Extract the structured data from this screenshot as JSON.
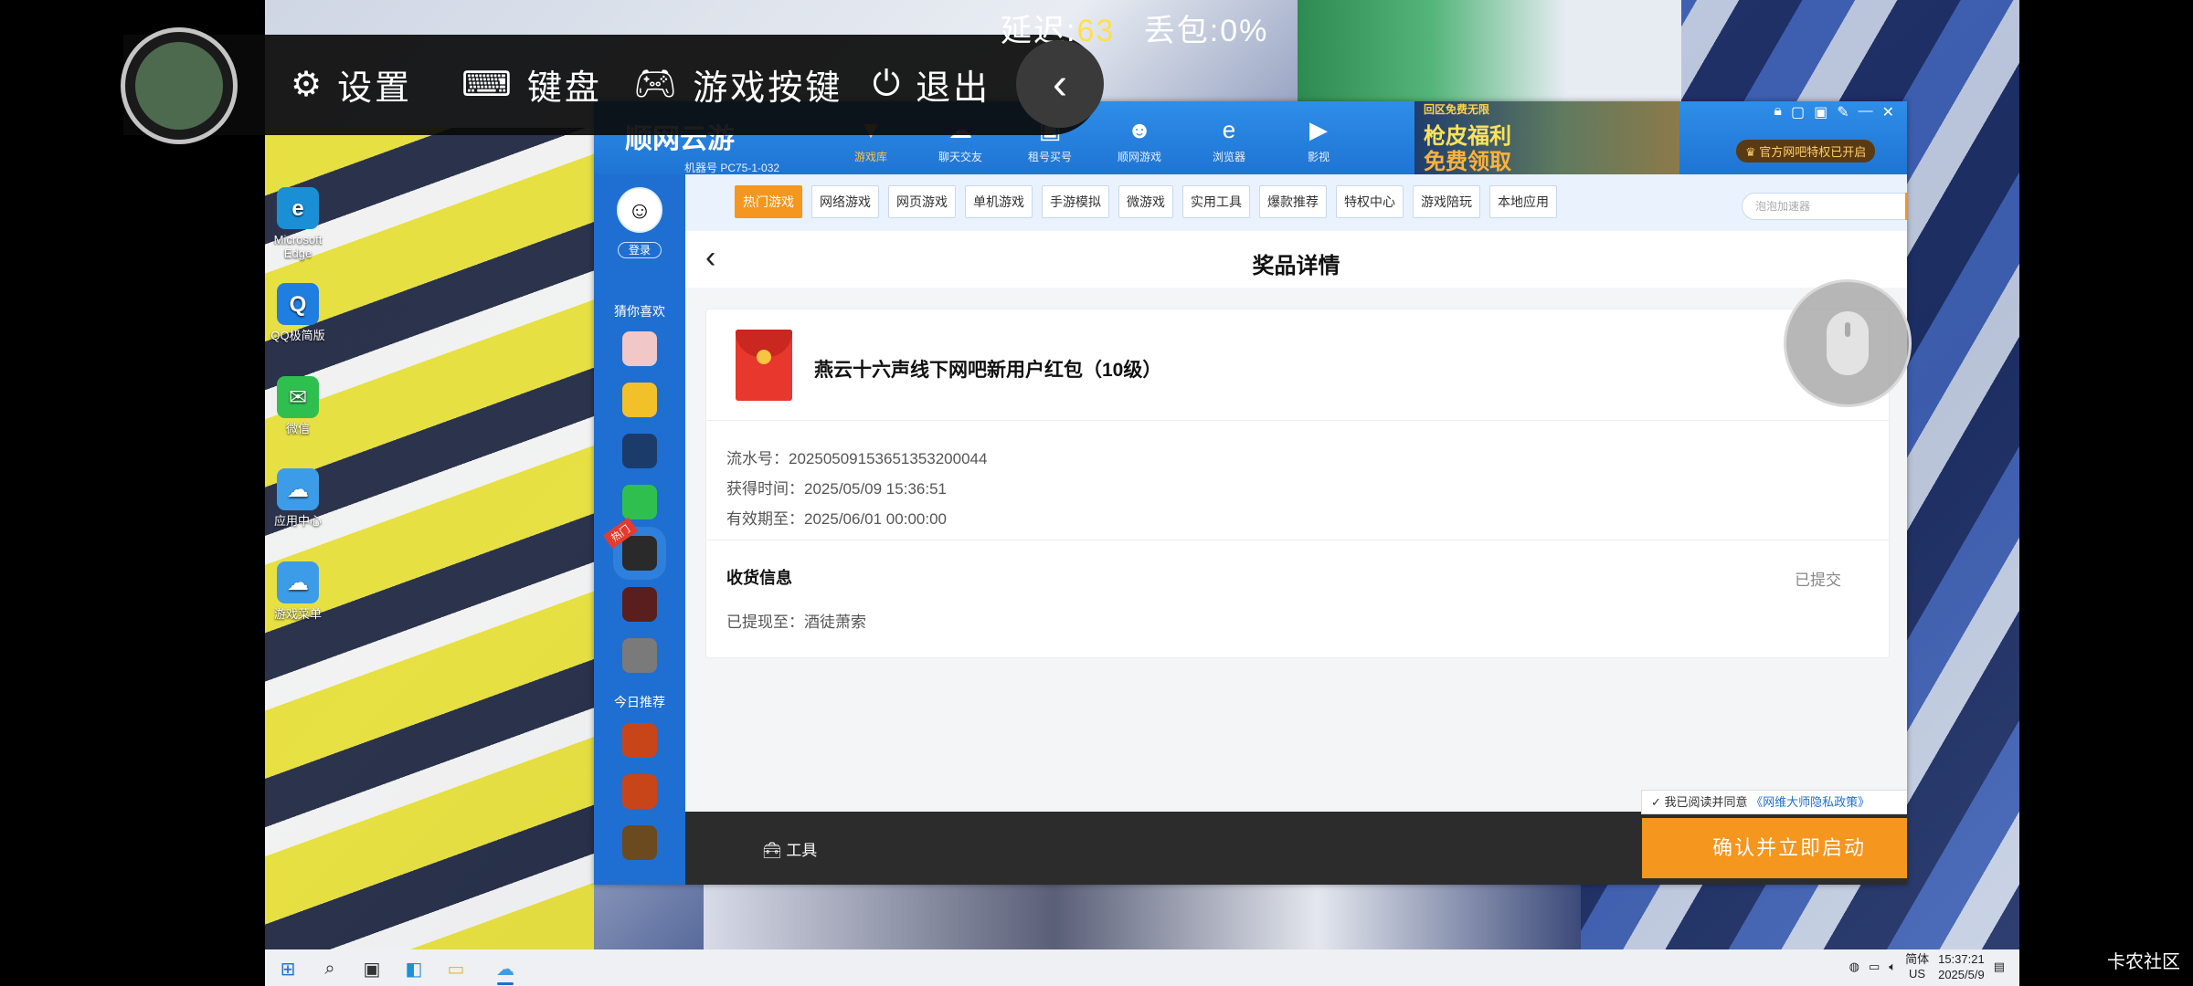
{
  "overlay": {
    "netstat": {
      "latency_label": "延迟:",
      "latency_value": "63",
      "loss_label": "丢包:",
      "loss_value": "0%"
    },
    "items": [
      {
        "icon": "gear-icon",
        "label": "设置"
      },
      {
        "icon": "keyboard-icon",
        "label": "键盘"
      },
      {
        "icon": "gamepad-icon",
        "label": "游戏按键"
      },
      {
        "icon": "power-icon",
        "label": "退出"
      }
    ]
  },
  "desktop_icons": [
    {
      "label": "Microsoft Edge",
      "icon": "edge-icon",
      "color": "#1a8fd6"
    },
    {
      "label": "QQ极简版",
      "icon": "qq-icon",
      "color": "#1f7fe0"
    },
    {
      "label": "微信",
      "icon": "wechat-icon",
      "color": "#2fbf4f"
    },
    {
      "label": "应用中心",
      "icon": "cloud-app-icon",
      "color": "#3c9ce8"
    },
    {
      "label": "游戏菜单",
      "icon": "cloud-game-icon",
      "color": "#3c9ce8"
    }
  ],
  "app": {
    "logo": "顺网云游",
    "machine_id": "机器号 PC75-1-032",
    "top_nav": [
      {
        "label": "游戏库",
        "active": true
      },
      {
        "label": "聊天交友",
        "active": false
      },
      {
        "label": "租号买号",
        "active": false
      },
      {
        "label": "顺网游戏",
        "active": false
      },
      {
        "label": "浏览器",
        "active": false
      },
      {
        "label": "影视",
        "active": false
      }
    ],
    "banner": {
      "line1": "回区免费无限",
      "line2": "枪皮福利",
      "line3": "免费领取"
    },
    "vip_tag": "官方网吧特权已开启",
    "sidebar": {
      "login": "登录",
      "guess_label": "猜你喜欢",
      "today_label": "今日推荐",
      "hot_label": "热门"
    },
    "categories": [
      {
        "label": "热门游戏",
        "active": true
      },
      {
        "label": "网络游戏",
        "active": false
      },
      {
        "label": "网页游戏",
        "active": false
      },
      {
        "label": "单机游戏",
        "active": false
      },
      {
        "label": "手游模拟",
        "active": false
      },
      {
        "label": "微游戏",
        "active": false
      },
      {
        "label": "实用工具",
        "active": false
      },
      {
        "label": "爆款推荐",
        "active": false
      },
      {
        "label": "特权中心",
        "active": false
      },
      {
        "label": "游戏陪玩",
        "active": false
      },
      {
        "label": "本地应用",
        "active": false
      }
    ],
    "search_placeholder": "泡泡加速器",
    "detail": {
      "title": "奖品详情",
      "prize_name": "燕云十六声线下网吧新用户红包（10级）",
      "serial": "流水号：20250509153651353200044",
      "obtained": "获得时间：2025/05/09 15:36:51",
      "expires": "有效期至：2025/06/01 00:00:00",
      "receive_title": "收货信息",
      "receive_status": "已提交",
      "receive_line": "已提现至：酒徒萧索"
    },
    "bottom": {
      "tool_label": "工具",
      "agree_text": "我已阅读并同意",
      "agree_link": "《网维大师隐私政策》",
      "start_button": "确认并立即启动"
    }
  },
  "taskbar": {
    "lang_top": "简体",
    "lang_bottom": "US",
    "time": "15:37:21",
    "date": "2025/5/9"
  },
  "watermark": "卡农社区"
}
